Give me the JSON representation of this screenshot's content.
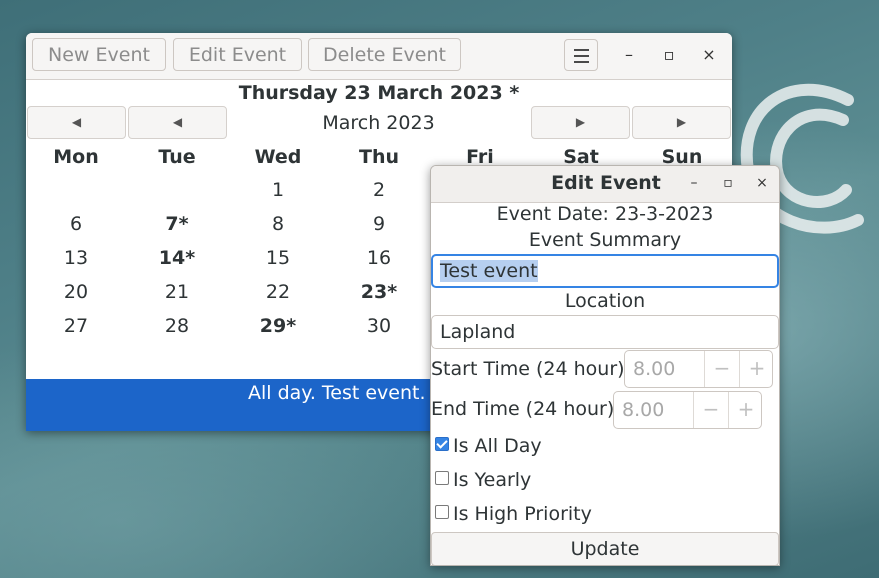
{
  "main_window": {
    "toolbar": {
      "new_event": "New Event",
      "edit_event": "Edit Event",
      "delete_event": "Delete Event"
    },
    "window_controls": {
      "minimize": "–",
      "maximize": "▫",
      "close": "×"
    },
    "selected_date_title": "Thursday 23 March 2023 *",
    "month_label": "March 2023",
    "nav": {
      "prev_year": "◀",
      "prev_month": "◀",
      "next_month": "▶",
      "next_year": "▶"
    },
    "weekdays": [
      "Mon",
      "Tue",
      "Wed",
      "Thu",
      "Fri",
      "Sat",
      "Sun"
    ],
    "weeks": [
      [
        {
          "label": "",
          "bold": false
        },
        {
          "label": "",
          "bold": false
        },
        {
          "label": "1",
          "bold": false
        },
        {
          "label": "2",
          "bold": false
        }
      ],
      [
        {
          "label": "6",
          "bold": false
        },
        {
          "label": "7*",
          "bold": true
        },
        {
          "label": "8",
          "bold": false
        },
        {
          "label": "9",
          "bold": false
        }
      ],
      [
        {
          "label": "13",
          "bold": false
        },
        {
          "label": "14*",
          "bold": true
        },
        {
          "label": "15",
          "bold": false
        },
        {
          "label": "16",
          "bold": false
        }
      ],
      [
        {
          "label": "20",
          "bold": false
        },
        {
          "label": "21",
          "bold": false
        },
        {
          "label": "22",
          "bold": false
        },
        {
          "label": "23*",
          "bold": true
        }
      ],
      [
        {
          "label": "27",
          "bold": false
        },
        {
          "label": "28",
          "bold": false
        },
        {
          "label": "29*",
          "bold": true
        },
        {
          "label": "30",
          "bold": false
        }
      ]
    ],
    "event_list": [
      "All day. Test event."
    ]
  },
  "edit_dialog": {
    "title": "Edit Event",
    "event_date": "Event Date: 23-3-2023",
    "summary_label": "Event Summary",
    "summary_value": "Test event",
    "location_label": "Location",
    "location_value": "Lapland",
    "start_label": "Start Time (24 hour)",
    "start_value": "8.00",
    "end_label": "End Time (24 hour)",
    "end_value": "8.00",
    "spin_minus": "−",
    "spin_plus": "+",
    "checkboxes": [
      {
        "label": "Is All Day",
        "checked": true
      },
      {
        "label": "Is Yearly",
        "checked": false
      },
      {
        "label": "Is High Priority",
        "checked": false
      }
    ],
    "update_button": "Update"
  },
  "colors": {
    "accent": "#3584e4",
    "selection_bar": "#1c65c9"
  }
}
